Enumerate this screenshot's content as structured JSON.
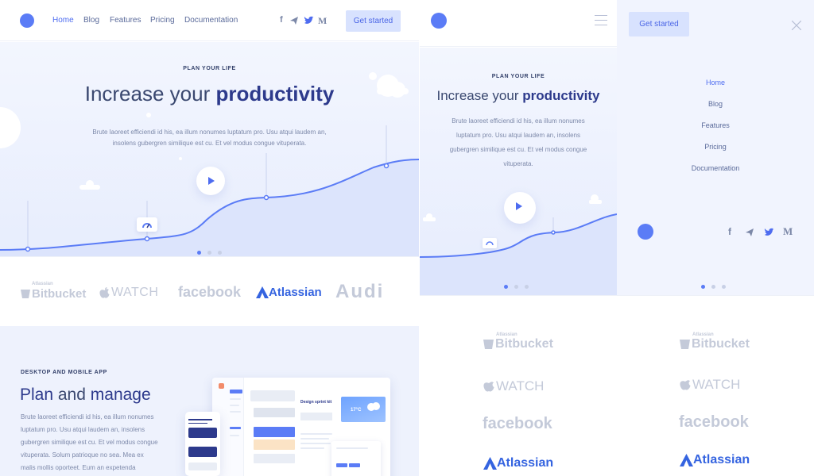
{
  "desktop": {
    "nav": {
      "links": [
        "Home",
        "Blog",
        "Features",
        "Pricing",
        "Documentation"
      ],
      "cta": "Get started"
    },
    "hero": {
      "eyebrow": "PLAN YOUR LIFE",
      "title_light": "Increase your",
      "title_bold": "productivity",
      "lead_line1": "Brute laoreet efficiendi id his, ea illum nonumes luptatum pro. Usu atqui laudem an,",
      "lead_line2": "insolens gubergren similique est cu. Et vel modus congue vituperata."
    },
    "brands": [
      {
        "small": "Atlassian",
        "name": "Bitbucket"
      },
      {
        "small": "",
        "name": "WATCH"
      },
      {
        "small": "",
        "name": "facebook"
      },
      {
        "small": "",
        "name": "Atlassian"
      },
      {
        "small": "",
        "name": "Audi"
      }
    ],
    "section2": {
      "eyebrow": "DESKTOP AND MOBILE APP",
      "title_bold1": "Plan",
      "title_light": "and",
      "title_bold2": "manage",
      "body_lines": [
        "Brute laoreet efficiendi id his, ea illum nonumes",
        "luptatum pro. Usu atqui laudem an, insolens",
        "gubergren similique est cu. Et vel modus congue",
        "vituperata. Solum patrioque no sea. Mea ex",
        "malis mollis oporteet. Eum an expetenda"
      ],
      "mockup": {
        "card_title": "Design sprint kit",
        "temp": "17°C"
      }
    }
  },
  "mobile": {
    "cta": "Get started",
    "hero": {
      "eyebrow": "PLAN YOUR LIFE",
      "title_light": "Increase your",
      "title_bold": "productivity",
      "lead_lines": [
        "Brute laoreet efficiendi id his, ea illum nonumes",
        "luptatum pro. Usu atqui laudem an, insolens",
        "gubergren similique est cu. Et vel modus congue",
        "vituperata."
      ]
    },
    "menu": {
      "links": [
        "Home",
        "Blog",
        "Features",
        "Pricing",
        "Documentation"
      ]
    },
    "brands_left": [
      {
        "small": "Atlassian",
        "name": "Bitbucket"
      },
      {
        "small": "",
        "name": "WATCH"
      },
      {
        "small": "",
        "name": "facebook"
      },
      {
        "small": "",
        "name": "Atlassian"
      }
    ],
    "brands_right": [
      {
        "small": "Atlassian",
        "name": "Bitbucket"
      },
      {
        "small": "",
        "name": "WATCH"
      },
      {
        "small": "",
        "name": "facebook"
      },
      {
        "small": "",
        "name": "Atlassian"
      }
    ]
  },
  "icons": [
    "logo-dot",
    "facebook-icon",
    "telegram-icon",
    "twitter-icon",
    "medium-icon",
    "play-icon",
    "hamburger-icon",
    "close-icon",
    "gauge-icon",
    "apple-icon",
    "bucket-icon",
    "cloud-icon"
  ],
  "colors": {
    "accent": "#5b7cf6",
    "cta_bg": "#d8e2fe",
    "hero_bg": "#eef2fd",
    "brand_muted": "#c4cad9",
    "atlassian": "#3564e0"
  }
}
